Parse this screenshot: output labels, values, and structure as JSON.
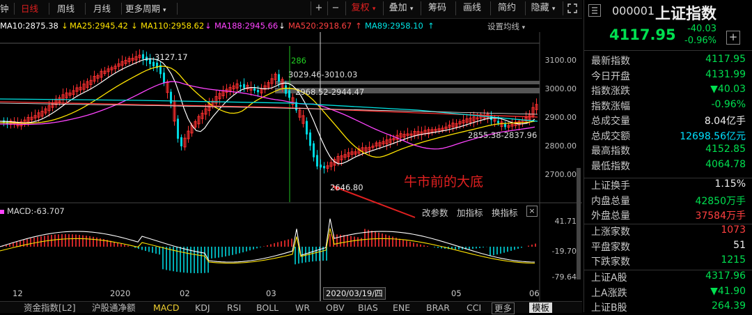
{
  "toolbar": {
    "cut_label": "钟",
    "daily": "日线",
    "weekly": "周线",
    "monthly": "月线",
    "more_period": "更多周期",
    "plus": "+",
    "minus": "−",
    "restore": "复权",
    "overlay": "叠加",
    "chips": "筹码",
    "draw": "画线",
    "simple": "简约",
    "hide": "隐藏"
  },
  "ma_row": {
    "ma10": "MA10:2875.38",
    "ma25": "MA25:2945.42",
    "ma110": "MA110:2958.62",
    "ma188": "MA188:2945.66",
    "ma520": "MA520:2918.67",
    "ma89": "MA89:2958.10",
    "settings": "设置均线",
    "colors": {
      "ma10": "#ffffff",
      "ma25": "#ffe400",
      "ma110": "#ff44ff",
      "ma188": "#ffffff",
      "ma520": "#ff4040",
      "ma89": "#00e5e5"
    }
  },
  "chart": {
    "annotations": {
      "high_label": "3127.17",
      "low_label": "2646.80",
      "v1286": "286",
      "range1": "3029.46-3010.03",
      "range2": "2968.52-2944.47",
      "range3": "2855.38-2837.96",
      "caption": "牛市前的大底"
    },
    "y_axis": [
      "3100.00",
      "3000.00",
      "2900.00",
      "2800.00",
      "2700.00"
    ],
    "x_axis": [
      "12",
      "2020",
      "02",
      "03",
      "2020/03/19/四",
      "05",
      "06"
    ],
    "macd_label": "MACD:-63.707",
    "macd_buttons": {
      "params": "改参数",
      "add": "加指标",
      "change": "换指标",
      "close": "×"
    },
    "macd_axis": [
      "41.71",
      "-19.70",
      "-79.64"
    ]
  },
  "panel": {
    "code": "000001",
    "name": "上证指数",
    "price": "4117.95",
    "change": "-40.03",
    "change_pct": "-0.96%",
    "add_btn": "+",
    "rows": [
      {
        "k": "最新指数",
        "v": "4117.95",
        "c": "#00e050"
      },
      {
        "k": "今日开盘",
        "v": "4131.99",
        "c": "#00e050"
      },
      {
        "k": "指数涨跌",
        "v": "▼40.03",
        "c": "#00e050"
      },
      {
        "k": "指数涨幅",
        "v": "-0.96%",
        "c": "#00e050"
      },
      {
        "k": "总成交量",
        "v": "8.04亿手",
        "c": "#f0f0f0"
      },
      {
        "k": "总成交额",
        "v": "12698.56亿元",
        "c": "#00e0ff"
      },
      {
        "k": "最高指数",
        "v": "4152.85",
        "c": "#00e050"
      },
      {
        "k": "最低指数",
        "v": "4064.78",
        "c": "#00e050"
      }
    ],
    "rows2": [
      {
        "k": "上证换手",
        "v": "1.15%",
        "c": "#f0f0f0"
      },
      {
        "k": "内盘总量",
        "v": "42850万手",
        "c": "#00e050"
      },
      {
        "k": "外盘总量",
        "v": "37584万手",
        "c": "#ff4040"
      }
    ],
    "rows3": [
      {
        "k": "上涨家数",
        "v": "1073",
        "c": "#ff4040"
      },
      {
        "k": "平盘家数",
        "v": "51",
        "c": "#f0f0f0"
      },
      {
        "k": "下跌家数",
        "v": "1215",
        "c": "#00e050"
      }
    ],
    "rows4": [
      {
        "k": "上证A股",
        "v": "4317.96",
        "c": "#00e050"
      },
      {
        "k": "上A涨跌",
        "v": "▼41.90",
        "c": "#00e050"
      },
      {
        "k": "上证B股",
        "v": "264.39",
        "c": "#00e050"
      }
    ]
  },
  "tabs": [
    "资金指数[L2]",
    "沪股通净额",
    "MACD",
    "KDJ",
    "RSI",
    "BOLL",
    "WR",
    "OBV",
    "BIAS",
    "ENE",
    "BRAR",
    "CCI",
    "更多",
    "模板"
  ]
}
